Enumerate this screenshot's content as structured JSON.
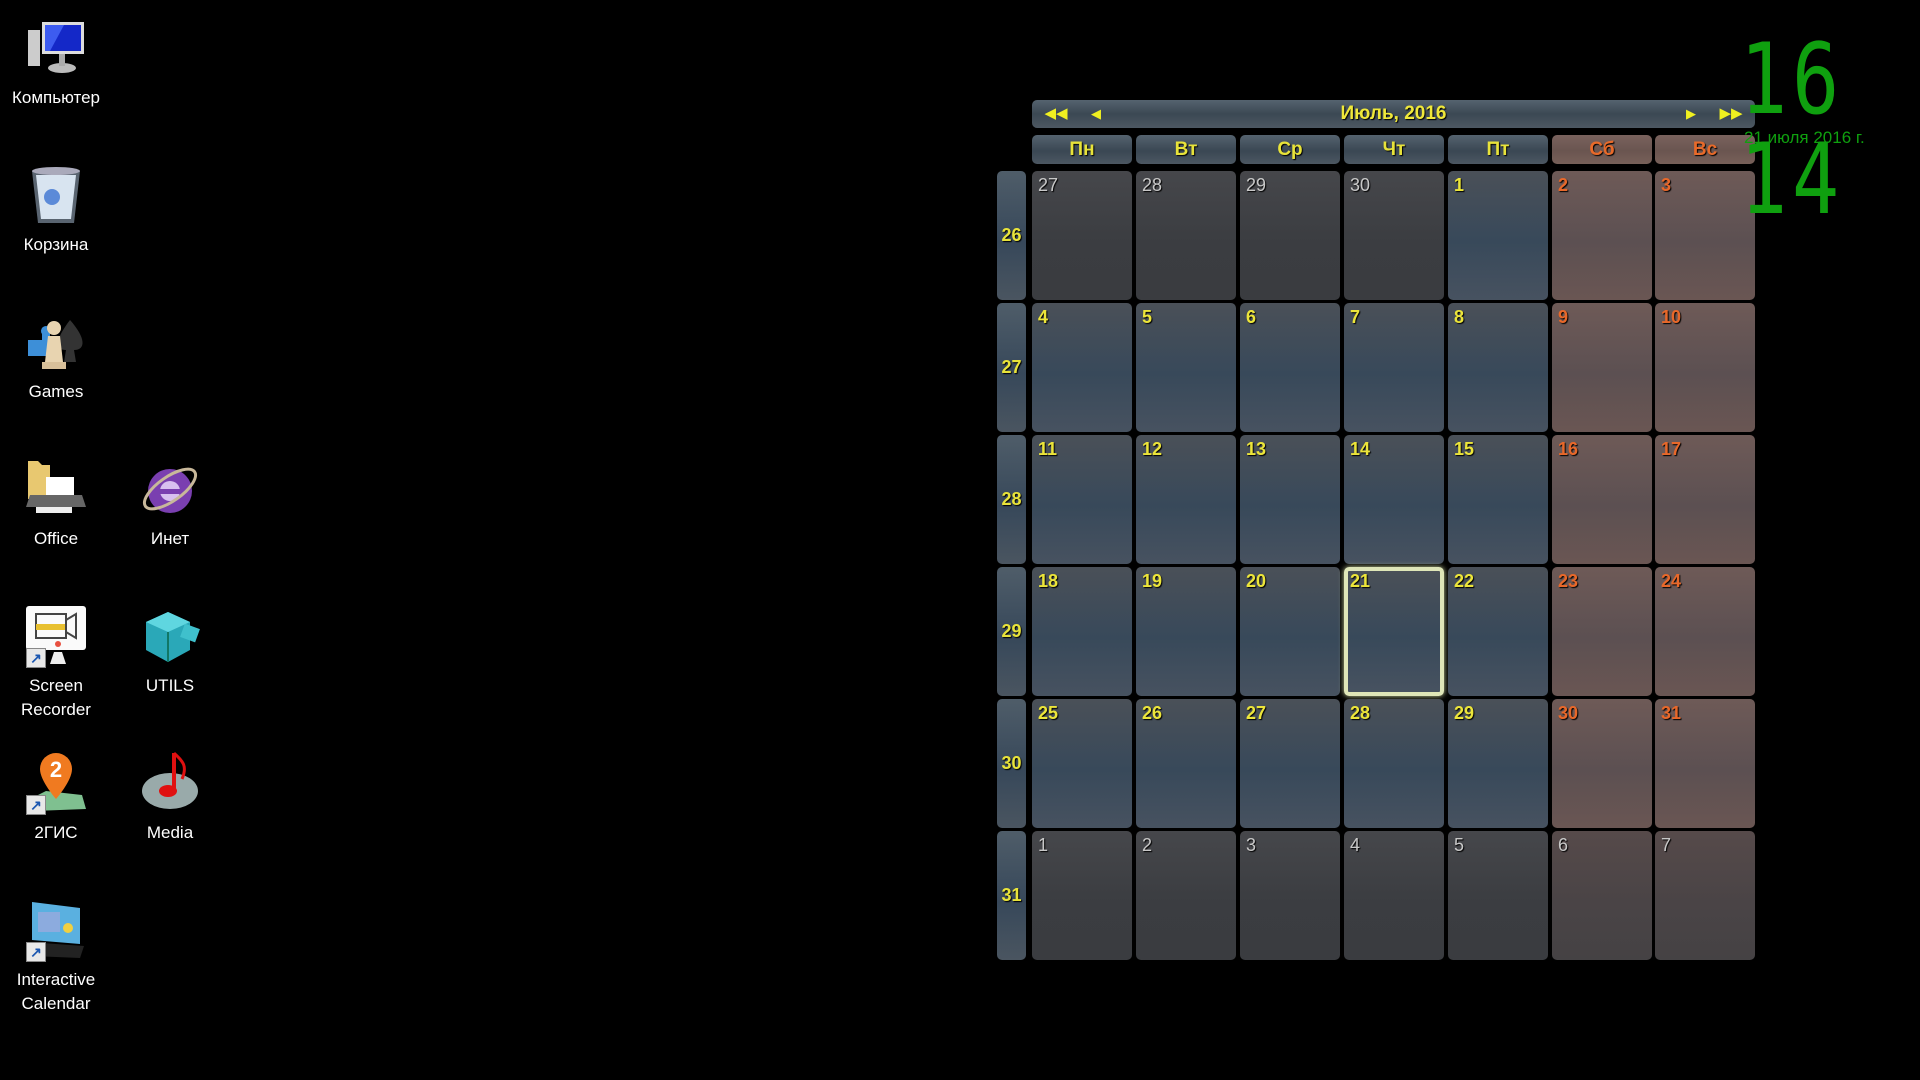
{
  "desktop": {
    "icons": [
      {
        "label": "Компьютер",
        "icon": "computer-icon"
      },
      {
        "label": "Корзина",
        "icon": "recycle-bin-icon"
      },
      {
        "label": "Games",
        "icon": "games-icon"
      },
      {
        "label": "Office",
        "icon": "folder-printer-icon"
      },
      {
        "label": "Инет",
        "icon": "internet-explorer-icon"
      },
      {
        "label": "Screen Recorder",
        "icon": "screen-recorder-icon",
        "shortcut": true
      },
      {
        "label": "UTILS",
        "icon": "cube-icon"
      },
      {
        "label": "2ГИС",
        "icon": "map-pin-icon",
        "shortcut": true
      },
      {
        "label": "Media",
        "icon": "music-disc-icon"
      },
      {
        "label": "Interactive Calendar",
        "icon": "calendar-app-icon",
        "shortcut": true
      }
    ]
  },
  "calendar": {
    "title": "Июль, 2016",
    "nav": {
      "prev_year": "◀◀",
      "prev_month": "◀",
      "next_month": "▶",
      "next_year": "▶▶"
    },
    "weekdays": [
      "Пн",
      "Вт",
      "Ср",
      "Чт",
      "Пт",
      "Сб",
      "Вс"
    ],
    "weekend_color": "#e8682a",
    "weekday_color": "#ece53a",
    "today": "21",
    "weeks": [
      {
        "num": "26",
        "days": [
          "27",
          "28",
          "29",
          "30",
          "1",
          "2",
          "3"
        ],
        "other_month": [
          true,
          true,
          true,
          true,
          false,
          false,
          false
        ]
      },
      {
        "num": "27",
        "days": [
          "4",
          "5",
          "6",
          "7",
          "8",
          "9",
          "10"
        ],
        "other_month": [
          false,
          false,
          false,
          false,
          false,
          false,
          false
        ]
      },
      {
        "num": "28",
        "days": [
          "11",
          "12",
          "13",
          "14",
          "15",
          "16",
          "17"
        ],
        "other_month": [
          false,
          false,
          false,
          false,
          false,
          false,
          false
        ]
      },
      {
        "num": "29",
        "days": [
          "18",
          "19",
          "20",
          "21",
          "22",
          "23",
          "24"
        ],
        "other_month": [
          false,
          false,
          false,
          false,
          false,
          false,
          false
        ]
      },
      {
        "num": "30",
        "days": [
          "25",
          "26",
          "27",
          "28",
          "29",
          "30",
          "31"
        ],
        "other_month": [
          false,
          false,
          false,
          false,
          false,
          false,
          false
        ]
      },
      {
        "num": "31",
        "days": [
          "1",
          "2",
          "3",
          "4",
          "5",
          "6",
          "7"
        ],
        "other_month": [
          true,
          true,
          true,
          true,
          true,
          true,
          true
        ]
      }
    ]
  },
  "clock": {
    "time": "16 14",
    "date": "21 июля 2016 г.",
    "color": "#0fa00f"
  }
}
